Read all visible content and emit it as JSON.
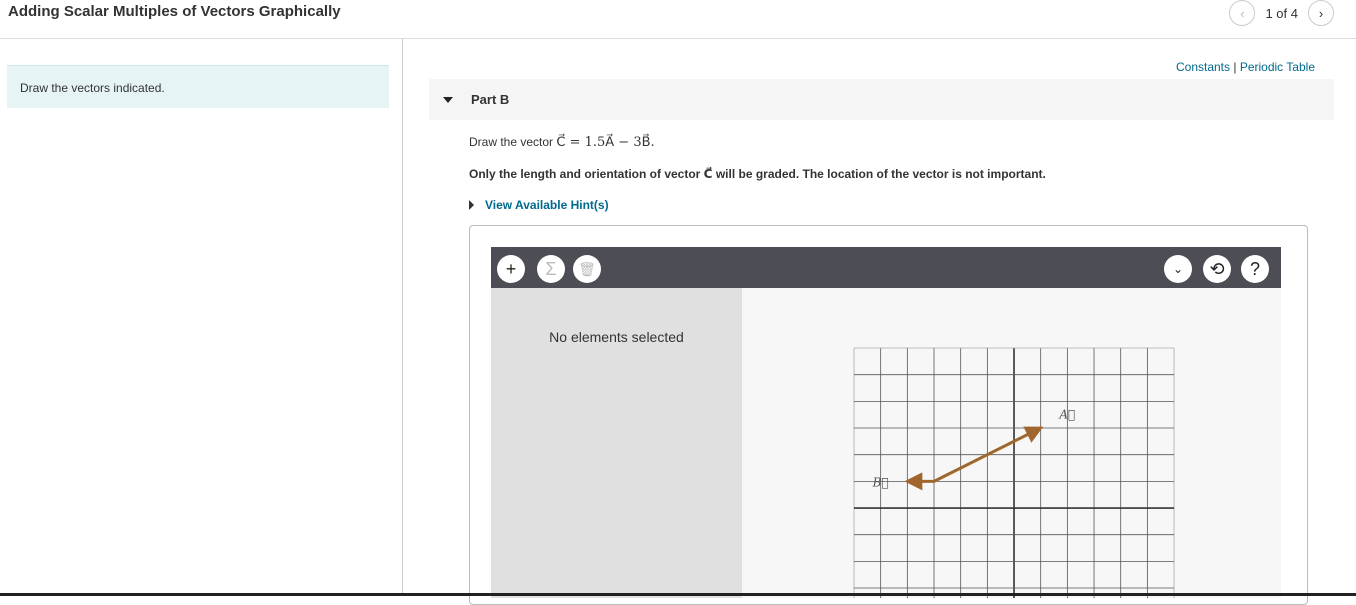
{
  "header": {
    "title": "Adding Scalar Multiples of Vectors Graphically",
    "pager": "1 of 4",
    "prev_icon": "chevron-left-icon",
    "next_icon": "chevron-right-icon"
  },
  "intro": "Draw the vectors indicated.",
  "links": {
    "constants": "Constants",
    "sep": "|",
    "periodic": "Periodic Table"
  },
  "part": {
    "label": "Part B"
  },
  "question": {
    "prefix": "Draw the vector ",
    "equation": "C⃗ = 1.5A⃗ − 3B⃗.",
    "note": "Only the length and orientation of vector C⃗ will be graded. The location of the vector is not important."
  },
  "hint": "View Available Hint(s)",
  "toolbar": {
    "add": "+",
    "sum": "Σ",
    "help": "?"
  },
  "side_panel": {
    "empty": "No elements selected"
  },
  "graph": {
    "vector_color": "#a0662e",
    "labels": {
      "A": "A⃗",
      "B": "B⃗"
    },
    "vectors": [
      {
        "name": "A",
        "tail": [
          -3,
          1
        ],
        "head": [
          1,
          3
        ]
      },
      {
        "name": "B",
        "tail": [
          -3,
          1
        ],
        "head": [
          -4,
          1
        ]
      }
    ]
  }
}
